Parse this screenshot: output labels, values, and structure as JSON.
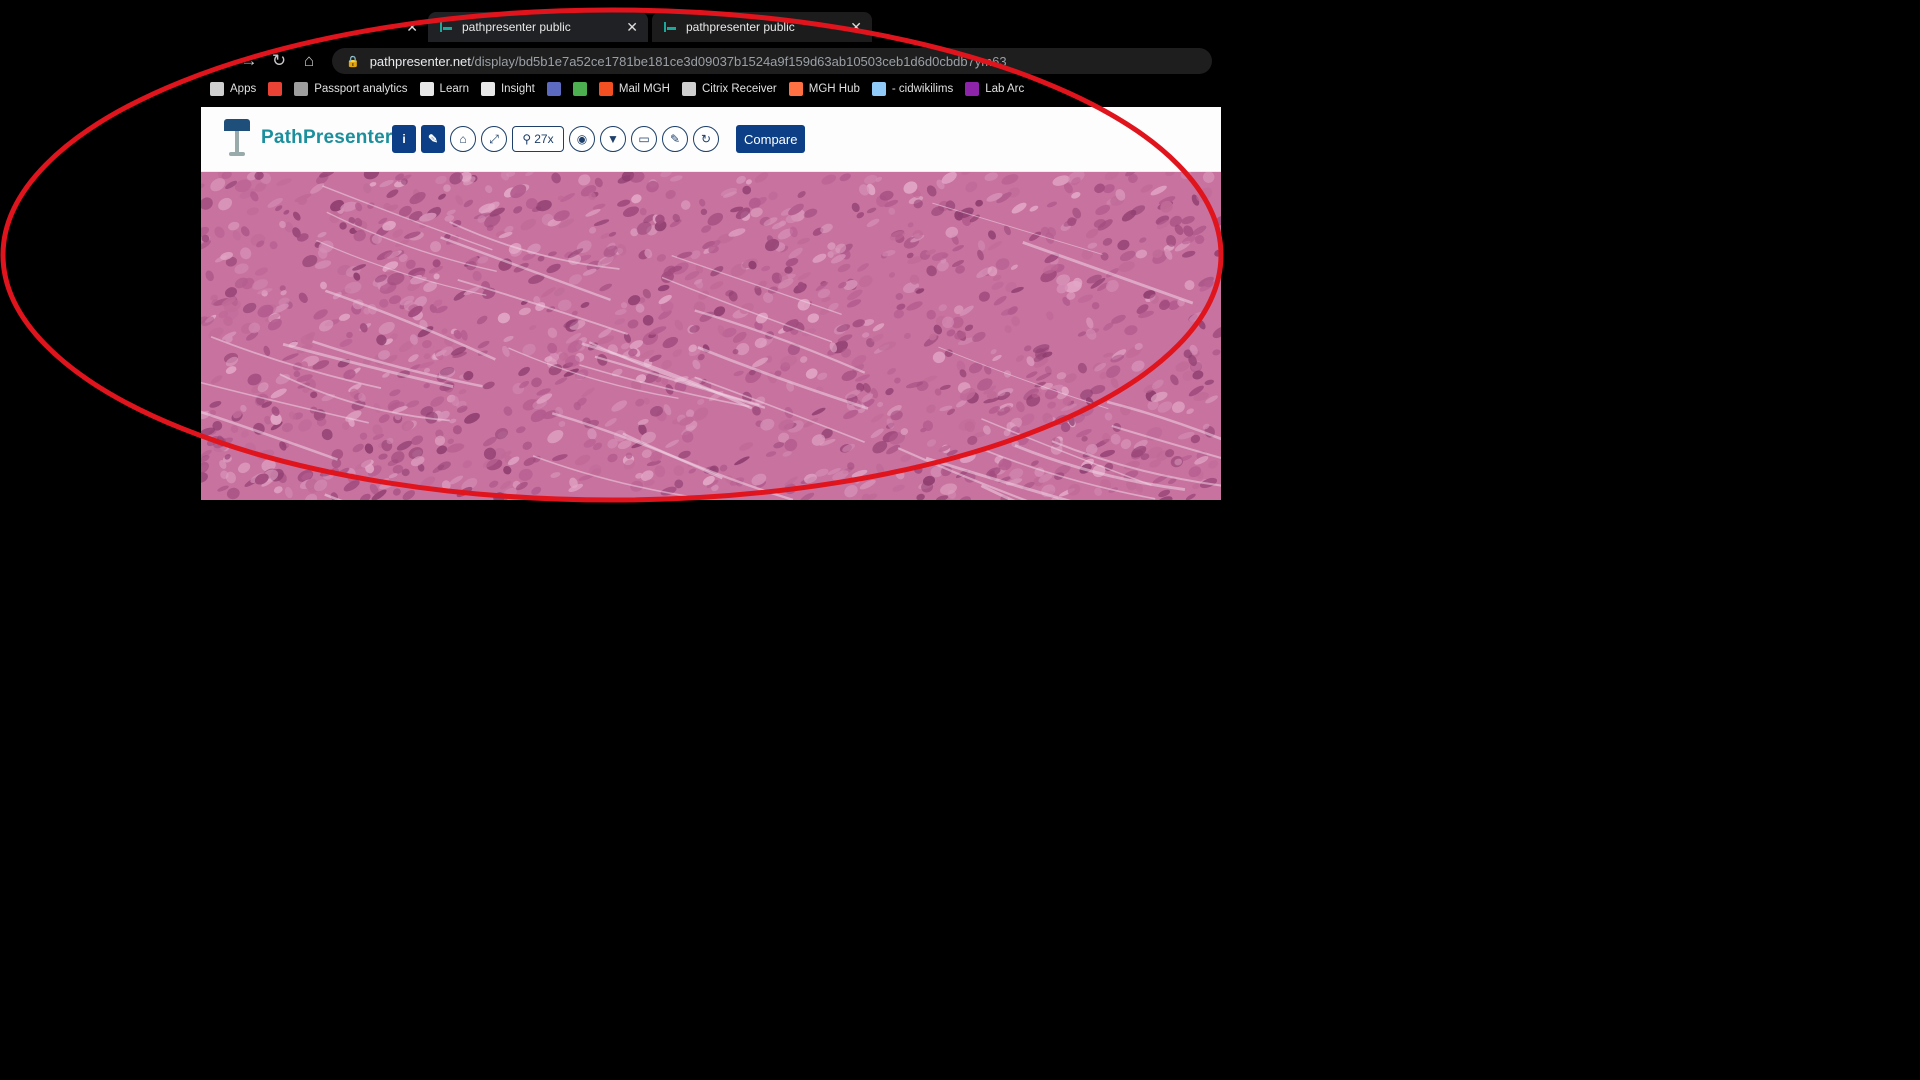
{
  "browser": {
    "tabs": [
      {
        "title": "",
        "close": "✕"
      },
      {
        "title": "pathpresenter public",
        "close": "✕"
      },
      {
        "title": "pathpresenter public",
        "close": "✕"
      }
    ],
    "url": {
      "host": "pathpresenter.net",
      "path": "/display/bd5b1e7a52ce1781be181ce3d09037b1524a9f159d63ab10503ceb1d6d0cbdb7ym63"
    },
    "bookmarks": [
      {
        "label": "Apps",
        "icon": "apps-grid-icon",
        "color": "#cfcfcf"
      },
      {
        "label": "",
        "icon": "gmail-icon",
        "color": "#ea4335"
      },
      {
        "label": "Passport analytics",
        "icon": "infinity-icon",
        "color": "#9e9e9e"
      },
      {
        "label": "Learn",
        "icon": "learn-icon",
        "color": "#e8e8e8"
      },
      {
        "label": "Insight",
        "icon": "insight-icon",
        "color": "#e8e8e8"
      },
      {
        "label": "",
        "icon": "half-circle-icon",
        "color": "#5c6bc0"
      },
      {
        "label": "",
        "icon": "box-icon",
        "color": "#4caf50"
      },
      {
        "label": "Mail MGH",
        "icon": "microsoft-icon",
        "color": "#f25022"
      },
      {
        "label": "Citrix Receiver",
        "icon": "citrix-icon",
        "color": "#cfcfcf"
      },
      {
        "label": "MGH Hub",
        "icon": "hub-icon",
        "color": "#ff7043"
      },
      {
        "label": "- cidwikilims",
        "icon": "wiki-icon",
        "color": "#90caf9"
      },
      {
        "label": "Lab Arc",
        "icon": "lab-icon",
        "color": "#8e24aa"
      }
    ]
  },
  "app": {
    "logo_text": "PathPresenter",
    "toolbar": {
      "info": "i",
      "zoom_level": "27x",
      "compare_label": "Compare"
    }
  },
  "colors": {
    "annotation_ellipse": "#e0141c",
    "tissue_base": "#c7729f",
    "brand_blue": "#0d3f86",
    "brand_teal": "#1b8f9c"
  }
}
